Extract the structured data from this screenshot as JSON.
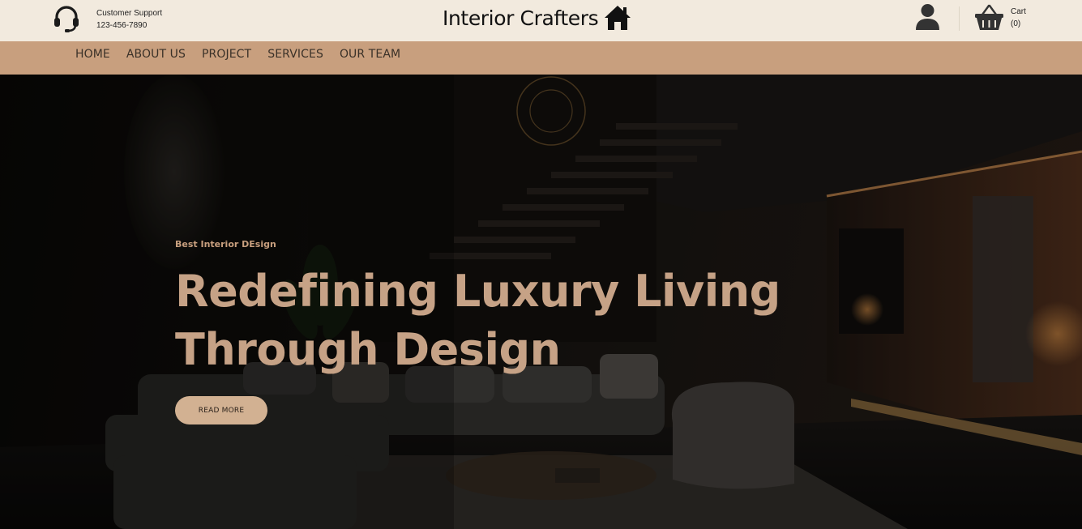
{
  "header": {
    "support_title": "Customer Support",
    "support_phone": "123-456-7890",
    "brand_name": "Interior Crafters",
    "cart_label": "Cart",
    "cart_count": "(0)",
    "icons": {
      "support": "headset-icon",
      "brand": "house-icon",
      "account": "user-icon",
      "cart": "shopping-basket-icon"
    }
  },
  "nav": {
    "items": [
      {
        "label": "HOME"
      },
      {
        "label": "ABOUT US"
      },
      {
        "label": "PROJECT"
      },
      {
        "label": "SERVICES"
      },
      {
        "label": "OUR TEAM"
      }
    ]
  },
  "hero": {
    "kicker": "Best Interior DEsign",
    "headline_line1": "Redefining Luxury Living",
    "headline_line2": "Through Design",
    "cta_label": "READ MORE"
  },
  "colors": {
    "topbar_bg": "#f2eade",
    "navbar_bg": "#c89f7e",
    "accent_text": "#c6a286",
    "button_bg": "#d2b192",
    "hero_bg": "#141210"
  }
}
